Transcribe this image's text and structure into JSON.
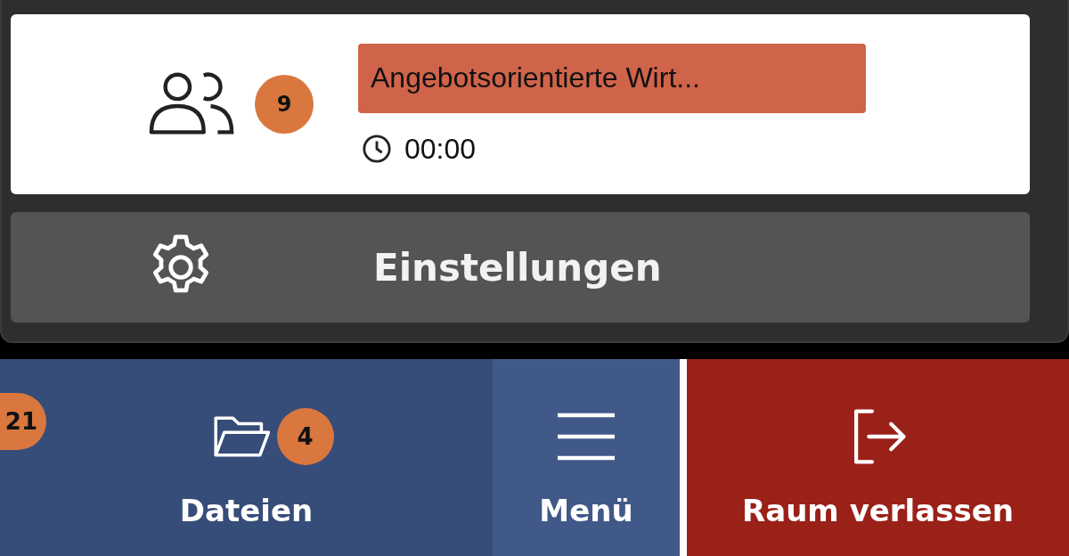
{
  "session_card": {
    "participant_count": "9",
    "topic": "Angebotsorientierte Wirt...",
    "time": "00:00"
  },
  "settings_button": {
    "label": "Einstellungen"
  },
  "bottom_bar": [
    {
      "kind": "files",
      "label": "Dateien",
      "badge": "4",
      "side_badge": "21"
    },
    {
      "kind": "menu",
      "label": "Menü"
    },
    {
      "kind": "leave",
      "label": "Raum verlassen"
    }
  ]
}
